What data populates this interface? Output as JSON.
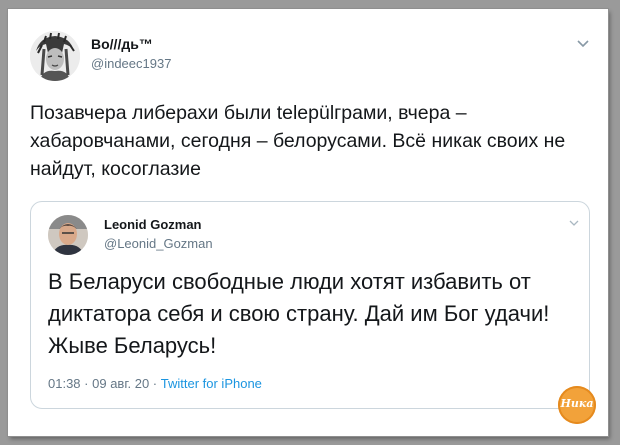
{
  "tweet": {
    "author_name": "Bo///дь™",
    "author_handle": "@indeec1937",
    "text": "Позавчера либерахи были települграми, вчера – хабаровчанами, сегодня – белорусами. Всё никак своих не найдут, косоглазие"
  },
  "quoted_tweet": {
    "author_name": "Leonid Gozman",
    "author_handle": "@Leonid_Gozman",
    "text": "В Беларуси свободные люди хотят избавить от диктатора себя и свою страну. Дай им Бог удачи! Жыве Беларусь!",
    "time": "01:38",
    "date": "09 авг. 20",
    "source": "Twitter for iPhone"
  },
  "watermark": {
    "text": "Ника",
    "color": "#f2a23a"
  },
  "colors": {
    "text": "#14171a",
    "secondary": "#657786",
    "link": "#1b95e0",
    "border": "#ccd6dd"
  },
  "icons": {
    "menu": "chevron-down-icon"
  }
}
